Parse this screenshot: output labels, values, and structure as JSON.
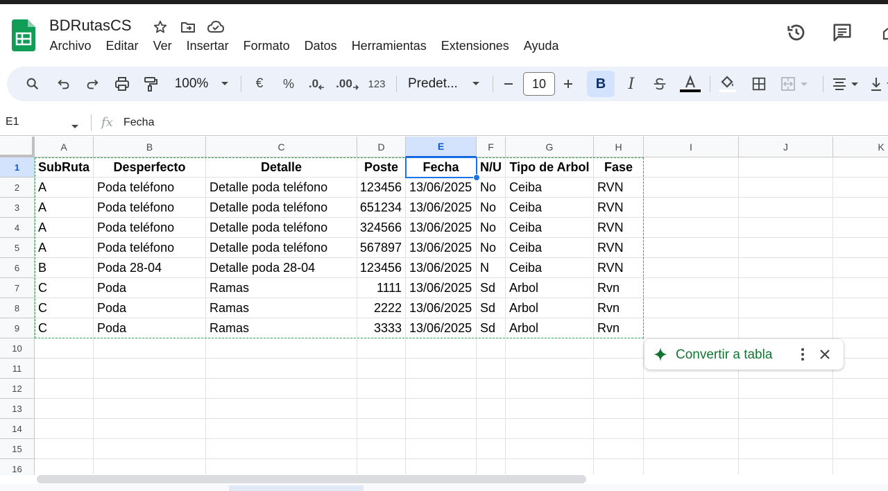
{
  "app": {
    "title": "BDRutasCS",
    "brand_color": "#0f9d58",
    "icons": [
      "star-icon",
      "move-to-folder-icon",
      "cloud-saved-icon",
      "history-icon",
      "comments-icon",
      "meet-icon"
    ]
  },
  "menu": [
    "Archivo",
    "Editar",
    "Ver",
    "Insertar",
    "Formato",
    "Datos",
    "Herramientas",
    "Extensiones",
    "Ayuda"
  ],
  "toolbar": {
    "zoom": "100%",
    "currency": "€",
    "percent": "%",
    "decimal_decrease": ".0",
    "decimal_increase": ".00",
    "number_format": "123",
    "font": "Predet...",
    "font_size": "10",
    "bold": "B",
    "italic": "I"
  },
  "formula_bar": {
    "cell_ref": "E1",
    "fx": "fx",
    "content": "Fecha"
  },
  "sheet": {
    "columns": [
      "A",
      "B",
      "C",
      "D",
      "E",
      "F",
      "G",
      "H",
      "I",
      "J",
      "K"
    ],
    "selected_column": "E",
    "row_numbers": [
      "1",
      "2",
      "3",
      "4",
      "5",
      "6",
      "7",
      "8",
      "9",
      "10",
      "11",
      "12",
      "13",
      "14",
      "15",
      "16"
    ],
    "header_row": [
      "SubRuta",
      "Desperfecto",
      "Detalle",
      "Poste",
      "Fecha",
      "N/U",
      "Tipo de Arbol",
      "Fase"
    ],
    "rows": [
      [
        "A",
        "Poda teléfono",
        "Detalle poda teléfono",
        "123456",
        "13/06/2025",
        "No",
        "Ceiba",
        "RVN"
      ],
      [
        "A",
        "Poda teléfono",
        "Detalle poda teléfono",
        "651234",
        "13/06/2025",
        "No",
        "Ceiba",
        "RVN"
      ],
      [
        "A",
        "Poda teléfono",
        "Detalle poda teléfono",
        "324566",
        "13/06/2025",
        "No",
        "Ceiba",
        "RVN"
      ],
      [
        "A",
        "Poda teléfono",
        "Detalle poda teléfono",
        "567897",
        "13/06/2025",
        "No",
        "Ceiba",
        "RVN"
      ],
      [
        "B",
        "Poda 28-04",
        "Detalle poda 28-04",
        "123456",
        "13/06/2025",
        "N",
        "Ceiba",
        "RVN"
      ],
      [
        "C",
        "Poda",
        "Ramas",
        "1111",
        "13/06/2025",
        "Sd",
        "Arbol",
        "Rvn"
      ],
      [
        "C",
        "Poda",
        "Ramas",
        "2222",
        "13/06/2025",
        "Sd",
        "Arbol",
        "Rvn"
      ],
      [
        "C",
        "Poda",
        "Ramas",
        "3333",
        "13/06/2025",
        "Sd",
        "Arbol",
        "Rvn"
      ]
    ]
  },
  "convert_chip": {
    "label": "Convertir a tabla",
    "color": "#137333"
  }
}
